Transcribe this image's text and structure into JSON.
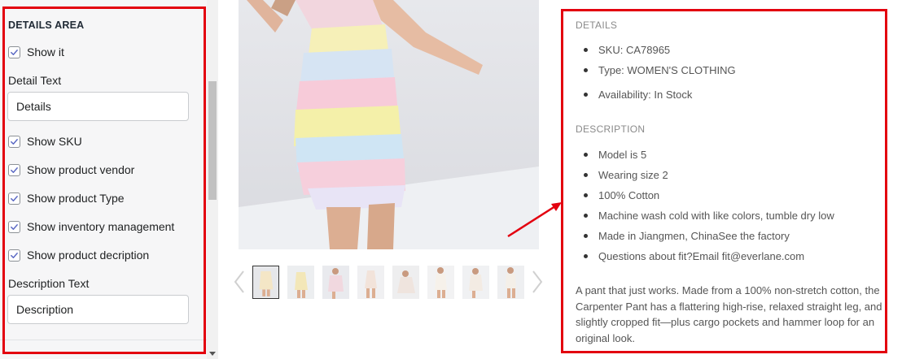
{
  "settings": {
    "section_title": "DETAILS AREA",
    "show_it": {
      "label": "Show it",
      "checked": true
    },
    "detail_text": {
      "label": "Detail Text",
      "value": "Details"
    },
    "options": [
      {
        "label": "Show SKU",
        "checked": true
      },
      {
        "label": "Show product vendor",
        "checked": true
      },
      {
        "label": "Show product Type",
        "checked": true
      },
      {
        "label": "Show inventory management",
        "checked": true
      },
      {
        "label": "Show product decription",
        "checked": true
      }
    ],
    "description_text": {
      "label": "Description Text",
      "value": "Description"
    }
  },
  "gallery": {
    "thumbnail_count": 8,
    "active_thumbnail": 1
  },
  "preview": {
    "details_heading": "DETAILS",
    "details": [
      "SKU: CA78965",
      "Type: WOMEN'S CLOTHING",
      "Availability: In Stock"
    ],
    "description_heading": "DESCRIPTION",
    "description_items": [
      "Model is 5",
      "Wearing size 2",
      "100% Cotton",
      "Machine wash cold with like colors, tumble dry low",
      "Made in Jiangmen, ChinaSee the factory",
      "Questions about fit?Email fit@everlane.com"
    ],
    "description_paragraph": "A pant that just works. Made from a 100% non-stretch cotton, the Carpenter Pant has a flattering high-rise, relaxed straight leg, and slightly cropped fit—plus cargo pockets and hammer loop for an original look."
  },
  "colors": {
    "highlight": "#e3000f",
    "checkbox_mark": "#5c6ac4"
  }
}
